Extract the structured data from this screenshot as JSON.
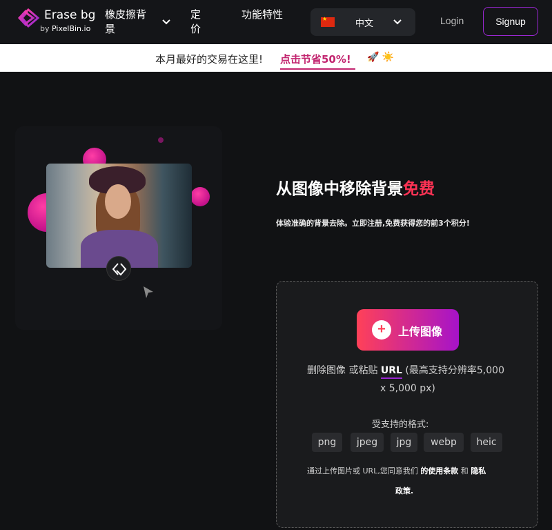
{
  "brand": {
    "title": "Erase bg",
    "by": "by",
    "company": "PixelBin.io",
    "colors": {
      "accent_pink": "#ff3355",
      "accent_purple": "#9b27d3",
      "link": "#c2256f"
    }
  },
  "nav": {
    "items": [
      {
        "label": "橡皮擦背景",
        "has_dropdown": true
      },
      {
        "label": "定价"
      },
      {
        "label": "功能特性"
      }
    ],
    "language": {
      "flag": "china-flag-icon",
      "label": "中文"
    },
    "login": "Login",
    "signup": "Signup"
  },
  "promo": {
    "text": "本月最好的交易在这里!",
    "link": "点击节省50%!",
    "emoji": "🚀 ☀️"
  },
  "hero": {
    "headline": "从图像中移除背景",
    "headline_accent": "免费",
    "subtitle": "体验准确的背景去除。立即注册,免费获得您的前3个积分!"
  },
  "upload": {
    "button_label": "上传图像",
    "drop_prefix": "删除图像 或粘贴 ",
    "drop_url": "URL",
    "drop_suffix": " (最高支持分辨率5,000",
    "drop_line2": "x 5,000 px)",
    "formats_title": "受支持的格式:",
    "formats": [
      "png",
      "jpeg",
      "jpg",
      "webp",
      "heic"
    ],
    "terms_prefix": "通过上传图片或 URL,您同意我们 ",
    "terms_link": "的使用条款",
    "terms_and": " 和 ",
    "terms_privacy_1": "隐私",
    "terms_privacy_2": "政策."
  }
}
